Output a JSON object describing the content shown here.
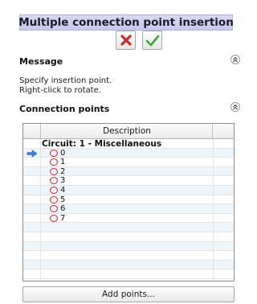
{
  "panel": {
    "title": "Multiple connection point insertion",
    "cancel_icon": "cancel-x-icon",
    "ok_icon": "checkmark-icon"
  },
  "message": {
    "title": "Message",
    "lines": [
      "Specify insertion point.",
      "Right-click to rotate."
    ]
  },
  "connection_points": {
    "title": "Connection points",
    "column_header": "Description",
    "group": "Circuit: 1 - Miscellaneous",
    "points": [
      "0",
      "1",
      "2",
      "3",
      "4",
      "5",
      "6",
      "7"
    ],
    "current_point": "0",
    "add_button_label": "Add points..."
  },
  "colors": {
    "title_bg": "#c8c8ea",
    "cancel_red": "#cc2a2a",
    "ok_green": "#3aa63a",
    "point_circle": "#d42020",
    "current_arrow": "#3d7fd8",
    "alt_row": "#eef6fc"
  }
}
